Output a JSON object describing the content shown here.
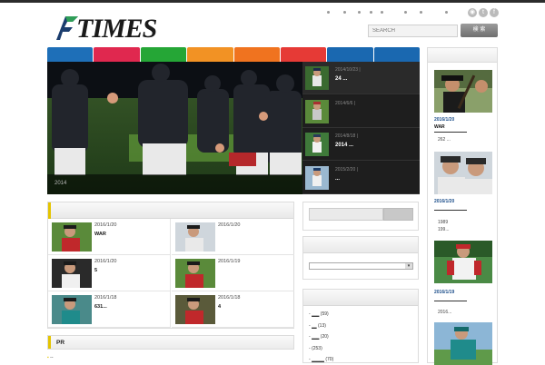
{
  "site": {
    "logo_text": "TIMES"
  },
  "header": {
    "search_placeholder": "SEARCH",
    "search_button": "検 索",
    "social_icons": [
      "rss-icon",
      "twitter-icon",
      "facebook-icon"
    ]
  },
  "nav": {
    "tabs": [
      {
        "color": "#1e6fb8"
      },
      {
        "color": "#e0284f"
      },
      {
        "color": "#25a636"
      },
      {
        "color": "#f29224"
      },
      {
        "color": "#f0731f"
      },
      {
        "color": "#e63a36"
      },
      {
        "color": "#1a68b0"
      },
      {
        "color": "#1a68b0"
      }
    ]
  },
  "slider": {
    "hero_caption": "2014",
    "items": [
      {
        "date": "2014/10/23",
        "title": "24 ..."
      },
      {
        "date": "2014/6/6",
        "title": ""
      },
      {
        "date": "2014/8/18",
        "title": "2014 ..."
      },
      {
        "date": "2015/2/20",
        "title": "..."
      }
    ]
  },
  "posts": [
    {
      "date": "2016/1/20",
      "title": "WAR"
    },
    {
      "date": "2016/1/20",
      "title": ""
    },
    {
      "date": "2016/1/20",
      "title": "5"
    },
    {
      "date": "2016/1/19",
      "title": ""
    },
    {
      "date": "2016/1/18",
      "title": "631..."
    },
    {
      "date": "2016/1/18",
      "title": "4"
    }
  ],
  "pr": {
    "title": "PR",
    "item": "--"
  },
  "categories": [
    {
      "label": "___",
      "count": "(59)"
    },
    {
      "label": "__",
      "count": "(13)"
    },
    {
      "label": "___",
      "count": "(20)"
    },
    {
      "label": "",
      "count": "(253)"
    },
    {
      "label": "_____",
      "count": "(70)"
    }
  ],
  "sidebar": {
    "items": [
      {
        "date": "2016/1/20",
        "title": "WAR",
        "note": "262 ..."
      },
      {
        "date": "2016/1/20",
        "title": "",
        "note": "1989\n199..."
      },
      {
        "date": "2016/1/19",
        "title": "",
        "note": "2016..."
      }
    ]
  }
}
